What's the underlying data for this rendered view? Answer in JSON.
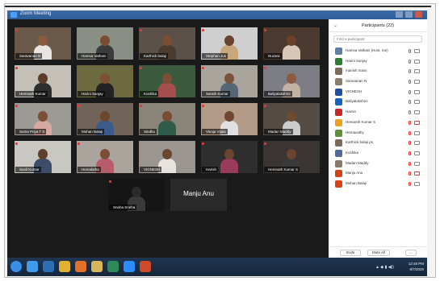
{
  "window": {
    "title": "Zoom Meeting"
  },
  "gallery": {
    "tiles": [
      {
        "name": "Saravanan N",
        "muted": true,
        "video": true,
        "bg": "#6b5a4a",
        "skin": "#8a5c3f",
        "shirt": "#e9e4df"
      },
      {
        "name": "Hamsa Vathani",
        "muted": false,
        "video": true,
        "bg": "#8a8f86",
        "skin": "#7a4d33",
        "shirt": "#3b3b3b"
      },
      {
        "name": "Karthick balaji",
        "muted": true,
        "video": true,
        "bg": "#5a5048",
        "skin": "#7b4e34",
        "shirt": "#4b3a2e"
      },
      {
        "name": "Stephan Jus",
        "muted": true,
        "video": true,
        "bg": "#cfcfcf",
        "skin": "#6a4330",
        "shirt": "#c9a77c"
      },
      {
        "name": "Nuzara",
        "muted": true,
        "video": true,
        "bg": "#4a3a30",
        "skin": "#6b3f2a",
        "shirt": "#d8c7b6"
      },
      {
        "name": "Hemnath Kumar",
        "muted": true,
        "video": true,
        "bg": "#c4c0b8",
        "skin": "#5c3b2a",
        "shirt": "#2e2e2e"
      },
      {
        "name": "Harini Sanjay",
        "muted": false,
        "video": true,
        "bg": "#6e6a3f",
        "skin": "#7d5036",
        "shirt": "#222222",
        "active": true
      },
      {
        "name": "Koshika",
        "muted": true,
        "video": true,
        "bg": "#3c5a3e",
        "skin": "#7c4f37",
        "shirt": "#a64d4d"
      },
      {
        "name": "Sarath Kumar",
        "muted": true,
        "video": true,
        "bg": "#a9a49c",
        "skin": "#7a5238",
        "shirt": "#556677"
      },
      {
        "name": "Baliyalakshmi",
        "muted": true,
        "video": true,
        "bg": "#7d7d86",
        "skin": "#8a5b3e",
        "shirt": "#c2b2a2"
      },
      {
        "name": "Suma Priya T S",
        "muted": true,
        "video": true,
        "bg": "#9c9a95",
        "skin": "#7b4e37",
        "shirt": "#d7a7a1"
      },
      {
        "name": "Mohan Balaji",
        "muted": true,
        "video": true,
        "bg": "#6f6457",
        "skin": "#6d4630",
        "shirt": "#3c5b8a"
      },
      {
        "name": "Sindhu",
        "muted": true,
        "video": true,
        "bg": "#8a8479",
        "skin": "#7a4c33",
        "shirt": "#2f5c4a"
      },
      {
        "name": "Vinoja Vijaia",
        "muted": true,
        "video": true,
        "bg": "#b39a86",
        "skin": "#6e4631",
        "shirt": "#e0e0e0"
      },
      {
        "name": "Madan Maddy",
        "muted": true,
        "video": true,
        "bg": "#544b45",
        "skin": "#6f4a33",
        "shirt": "#cccccc"
      },
      {
        "name": "Sunil Kumar",
        "muted": true,
        "video": true,
        "bg": "#c9c7c2",
        "skin": "#5f3e2c",
        "shirt": "#3d4c6a"
      },
      {
        "name": "Hemalatha",
        "muted": true,
        "video": true,
        "bg": "#aaa49d",
        "skin": "#7a4e36",
        "shirt": "#b85b6b"
      },
      {
        "name": "VIGNESH",
        "muted": false,
        "video": true,
        "bg": "#9a958e",
        "skin": "#6d4631",
        "shirt": "#e6e3de"
      },
      {
        "name": "Harish",
        "muted": true,
        "video": true,
        "bg": "#2e2e2e",
        "skin": "#6a4530",
        "shirt": "#9b3b5c"
      },
      {
        "name": "Hemnath Kumar S",
        "muted": true,
        "video": true,
        "bg": "#3a3532",
        "skin": "#6b4431",
        "shirt": "#3a3a3a"
      },
      {
        "name": "Sneha Sneha",
        "muted": true,
        "video": true,
        "bg": "#151515",
        "skin": "#2b2b2b",
        "shirt": "#3a3a3a"
      },
      {
        "name": "Manju Anu",
        "muted": true,
        "video": false
      }
    ]
  },
  "participants": {
    "title": "Participants (22)",
    "search_placeholder": "Find a participant",
    "list": [
      {
        "name": "Hamsa Vathani (Host, me)",
        "avatar": "#5b7fa6",
        "muted": false,
        "cam_off": false
      },
      {
        "name": "Harini Sanjay",
        "avatar": "#2e7d32",
        "muted": false,
        "cam_off": false
      },
      {
        "name": "manish mass",
        "avatar": "#7e6a58",
        "muted": false,
        "cam_off": false
      },
      {
        "name": "Saravanan N",
        "avatar": "#8d7d6d",
        "muted": false,
        "cam_off": false
      },
      {
        "name": "VIGNESH",
        "avatar": "#1e4fa3",
        "muted": false,
        "cam_off": false
      },
      {
        "name": "Baliyalakshmi",
        "avatar": "#1565c0",
        "muted": false,
        "cam_off": false
      },
      {
        "name": "Harsin",
        "avatar": "#c62828",
        "muted": false,
        "cam_off": false
      },
      {
        "name": "Hemanth Kumar S",
        "avatar": "#f0a020",
        "muted": true,
        "cam_off": true
      },
      {
        "name": "Hemavathy",
        "avatar": "#5d8f3a",
        "muted": true,
        "cam_off": false
      },
      {
        "name": "Karthick balaji ps",
        "avatar": "#7a6a5a",
        "muted": true,
        "cam_off": false
      },
      {
        "name": "Koshika",
        "avatar": "#4f6a9a",
        "muted": true,
        "cam_off": false
      },
      {
        "name": "Madan Maddy",
        "avatar": "#8a7a6a",
        "muted": true,
        "cam_off": false
      },
      {
        "name": "Manju Anu",
        "avatar": "#d84315",
        "muted": true,
        "cam_off": true
      },
      {
        "name": "Mohan Balaji",
        "avatar": "#d84315",
        "muted": true,
        "cam_off": false
      }
    ],
    "footer": {
      "invite": "Invite",
      "mute_all": "Mute All",
      "more": "..."
    }
  },
  "taskbar": {
    "icons": [
      {
        "name": "start-orb-icon",
        "color": "#3a8ee6"
      },
      {
        "name": "internet-explorer-icon",
        "color": "#3f9ae8"
      },
      {
        "name": "media-player-icon",
        "color": "#2c6fb7"
      },
      {
        "name": "chrome-icon",
        "color": "#e0b22f"
      },
      {
        "name": "firefox-icon",
        "color": "#e0702a"
      },
      {
        "name": "file-explorer-icon",
        "color": "#d8b45a"
      },
      {
        "name": "excel-icon",
        "color": "#2e8b57"
      },
      {
        "name": "zoom-icon",
        "color": "#2d8cff"
      },
      {
        "name": "powerpoint-icon",
        "color": "#d04a2a"
      }
    ],
    "time": "12:48 PM",
    "date": "8/7/2020"
  }
}
